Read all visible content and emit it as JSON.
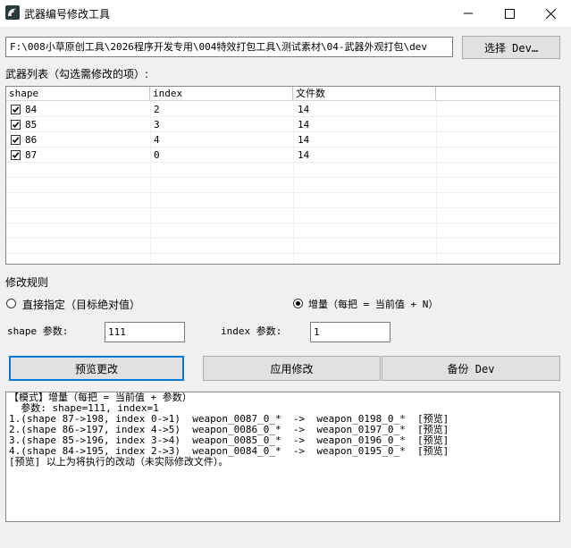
{
  "window": {
    "title": "武器编号修改工具",
    "icon": "dragon-app-icon"
  },
  "path": {
    "value": "F:\\008小草原创工具\\2026程序开发专用\\004特效打包工具\\测试素材\\04-武器外观打包\\dev",
    "select_label": "选择 Dev…"
  },
  "list": {
    "label": "武器列表（勾选需修改的项）:",
    "columns": [
      "shape",
      "index",
      "文件数",
      ""
    ],
    "rows": [
      {
        "checked": true,
        "shape": "84",
        "index": "2",
        "files": "14"
      },
      {
        "checked": true,
        "shape": "85",
        "index": "3",
        "files": "14"
      },
      {
        "checked": true,
        "shape": "86",
        "index": "4",
        "files": "14"
      },
      {
        "checked": true,
        "shape": "87",
        "index": "0",
        "files": "14"
      }
    ]
  },
  "rules": {
    "label": "修改规则",
    "option_direct": "直接指定（目标绝对值）",
    "option_increment": "增量（每把 = 当前值 + N）",
    "selected": "increment",
    "shape_label": "shape 参数:",
    "shape_value": "111",
    "index_label": "index 参数:",
    "index_value": "1"
  },
  "buttons": {
    "preview": "预览更改",
    "apply": "应用修改",
    "backup": "备份 Dev"
  },
  "log": {
    "lines": [
      "【模式】增量（每把 = 当前值 + 参数）",
      "  参数: shape=111, index=1",
      "1.(shape 87->198, index 0->1)  weapon_0087_0_*  ->  weapon_0198_0_*  [预览]",
      "2.(shape 86->197, index 4->5)  weapon_0086_0_*  ->  weapon_0197_0_*  [预览]",
      "3.(shape 85->196, index 3->4)  weapon_0085_0_*  ->  weapon_0196_0_*  [预览]",
      "4.(shape 84->195, index 2->3)  weapon_0084_0_*  ->  weapon_0195_0_*  [预览]",
      "[预览] 以上为将执行的改动（未实际修改文件）。"
    ]
  }
}
